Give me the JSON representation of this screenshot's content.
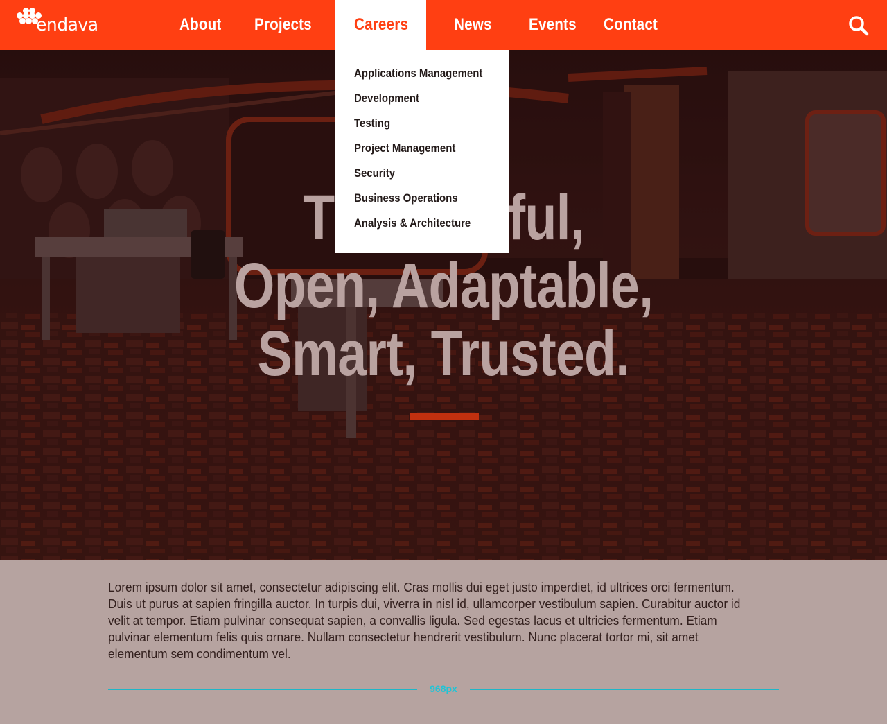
{
  "brand": {
    "name": "endava",
    "color": "#ff3f12"
  },
  "nav": {
    "items": [
      {
        "label": "About"
      },
      {
        "label": "Projects"
      },
      {
        "label": "Careers",
        "active": true
      },
      {
        "label": "News"
      },
      {
        "label": "Events"
      },
      {
        "label": "Contact"
      }
    ],
    "search_icon": "search-icon"
  },
  "careers_menu": {
    "items": [
      "Applications Management",
      "Development",
      "Testing",
      "Project Management",
      "Security",
      "Business Operations",
      "Analysis & Architecture"
    ]
  },
  "hero": {
    "lines": [
      "Thoughtful,",
      "Open, Adaptable,",
      "Smart, Trusted."
    ],
    "accent_color": "#c1300f"
  },
  "intro": {
    "paragraph": "Lorem ipsum dolor sit amet, consectetur adipiscing elit. Cras mollis dui eget justo imperdiet, id ultrices orci fermentum. Duis ut purus at sapien fringilla auctor. In turpis dui, viverra in nisl id, ullamcorper vestibulum sapien. Curabitur auctor id velit at tempor. Etiam pulvinar consequat sapien, a convallis ligula. Sed egestas lacus et ultricies fermentum. Etiam pulvinar elementum felis quis ornare. Nullam consectetur hendrerit vestibulum. Nunc placerat tortor mi, sit amet elementum sem condimentum vel."
  },
  "guide": {
    "label": "968px",
    "color": "#1fc4d6"
  }
}
